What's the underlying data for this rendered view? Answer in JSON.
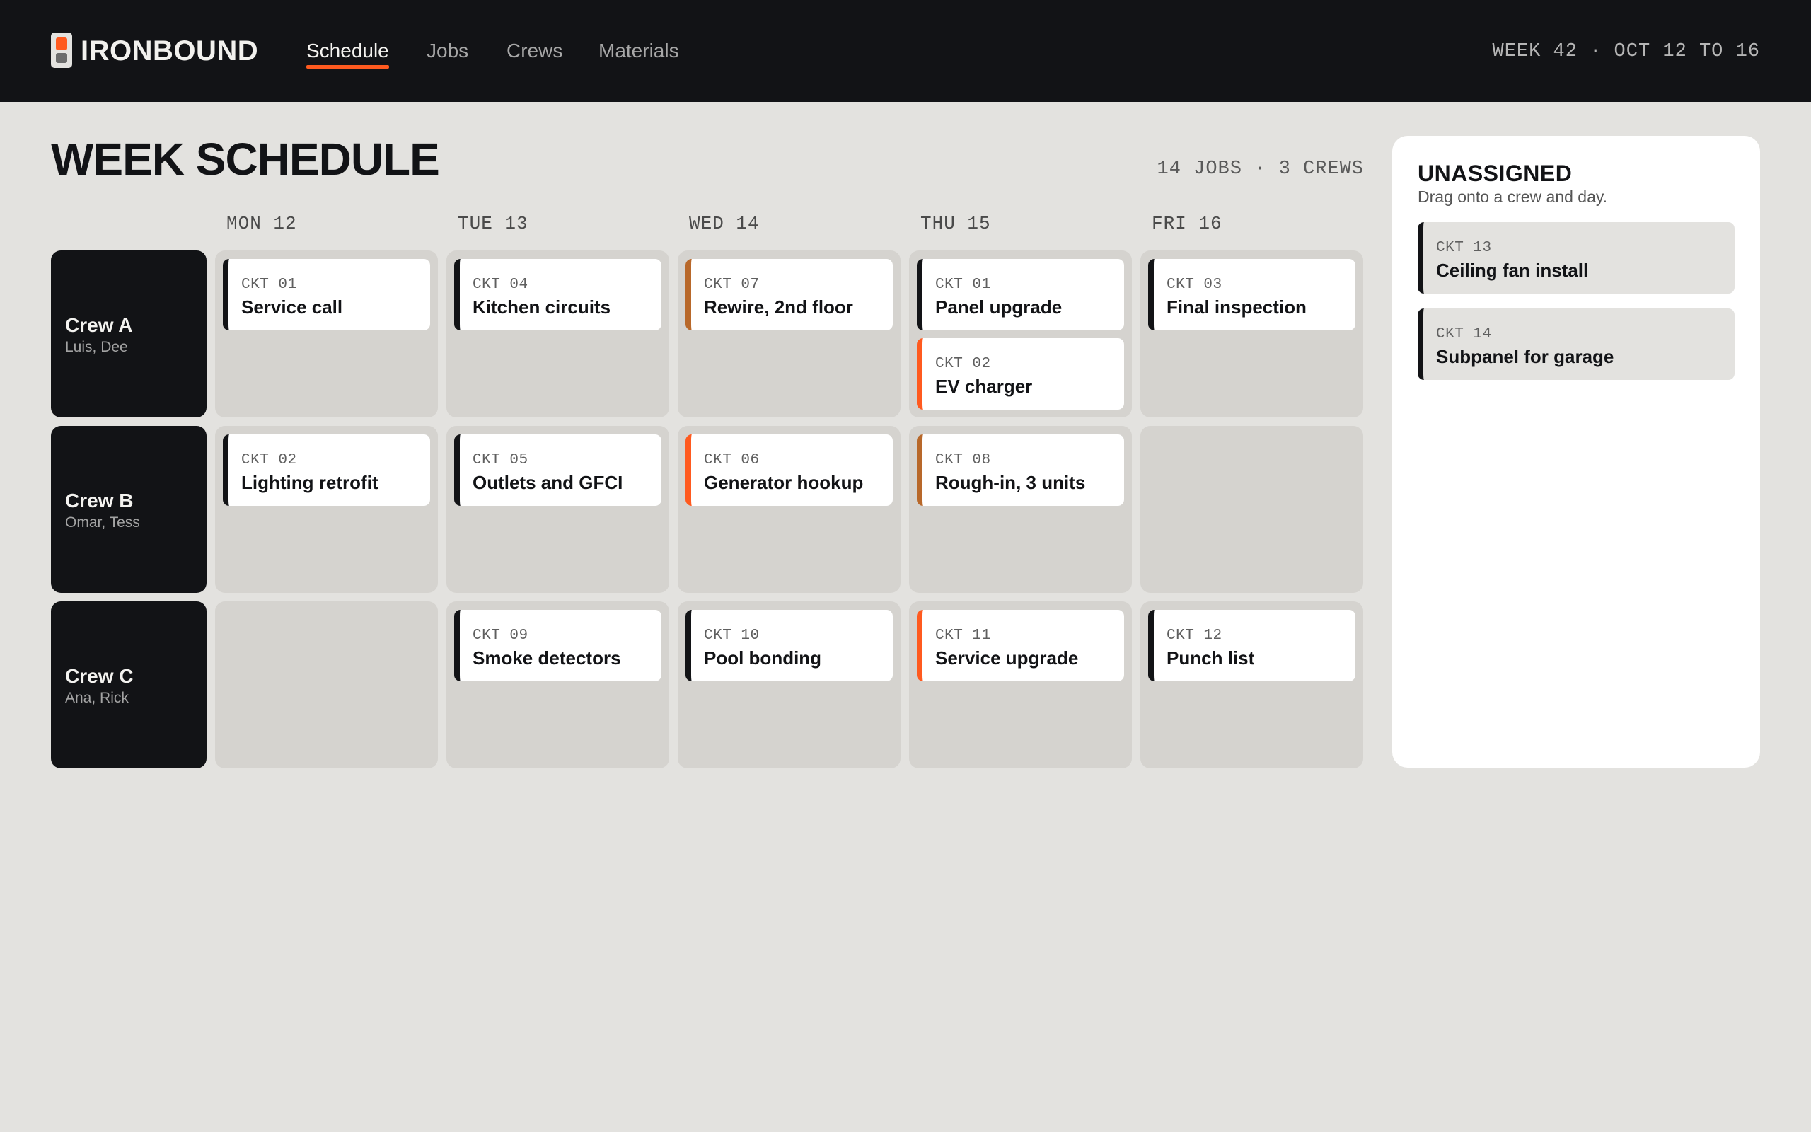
{
  "app": {
    "brand": "IRONBOUND",
    "week_range": "WEEK 42 · OCT 12 TO 16"
  },
  "nav": [
    {
      "label": "Schedule",
      "active": true
    },
    {
      "label": "Jobs",
      "active": false
    },
    {
      "label": "Crews",
      "active": false
    },
    {
      "label": "Materials",
      "active": false
    }
  ],
  "page": {
    "title": "WEEK SCHEDULE",
    "summary": "14 JOBS · 3 CREWS"
  },
  "days": [
    "MON 12",
    "TUE 13",
    "WED 14",
    "THU 15",
    "FRI 16"
  ],
  "crews": [
    {
      "name": "Crew A",
      "members": "Luis, Dee"
    },
    {
      "name": "Crew B",
      "members": "Omar, Tess"
    },
    {
      "name": "Crew C",
      "members": "Ana, Rick"
    }
  ],
  "jobs": {
    "a_mon": {
      "code": "CKT 01",
      "title": "Service call"
    },
    "a_tue": {
      "code": "CKT 04",
      "title": "Kitchen circuits"
    },
    "a_wed": {
      "code": "CKT 07",
      "title": "Rewire, 2nd floor"
    },
    "a_thu_1": {
      "code": "CKT 01",
      "title": "Panel upgrade"
    },
    "a_thu_2": {
      "code": "CKT 02",
      "title": "EV charger"
    },
    "a_fri": {
      "code": "CKT 03",
      "title": "Final inspection"
    },
    "b_mon": {
      "code": "CKT 02",
      "title": "Lighting retrofit"
    },
    "b_tue": {
      "code": "CKT 05",
      "title": "Outlets and GFCI"
    },
    "b_wed": {
      "code": "CKT 06",
      "title": "Generator hookup"
    },
    "b_thu": {
      "code": "CKT 08",
      "title": "Rough-in, 3 units"
    },
    "c_tue": {
      "code": "CKT 09",
      "title": "Smoke detectors"
    },
    "c_wed": {
      "code": "CKT 10",
      "title": "Pool bonding"
    },
    "c_thu": {
      "code": "CKT 11",
      "title": "Service upgrade"
    },
    "c_fri": {
      "code": "CKT 12",
      "title": "Punch list"
    }
  },
  "unassigned": {
    "title": "UNASSIGNED",
    "subtitle": "Drag onto a crew and day.",
    "items": [
      {
        "code": "CKT 13",
        "title": "Ceiling fan install"
      },
      {
        "code": "CKT 14",
        "title": "Subpanel for garage"
      }
    ]
  },
  "colors": {
    "accent": "#ff5a1f",
    "amber": "#b8682a",
    "ink": "#121316",
    "background": "#e3e2df"
  }
}
